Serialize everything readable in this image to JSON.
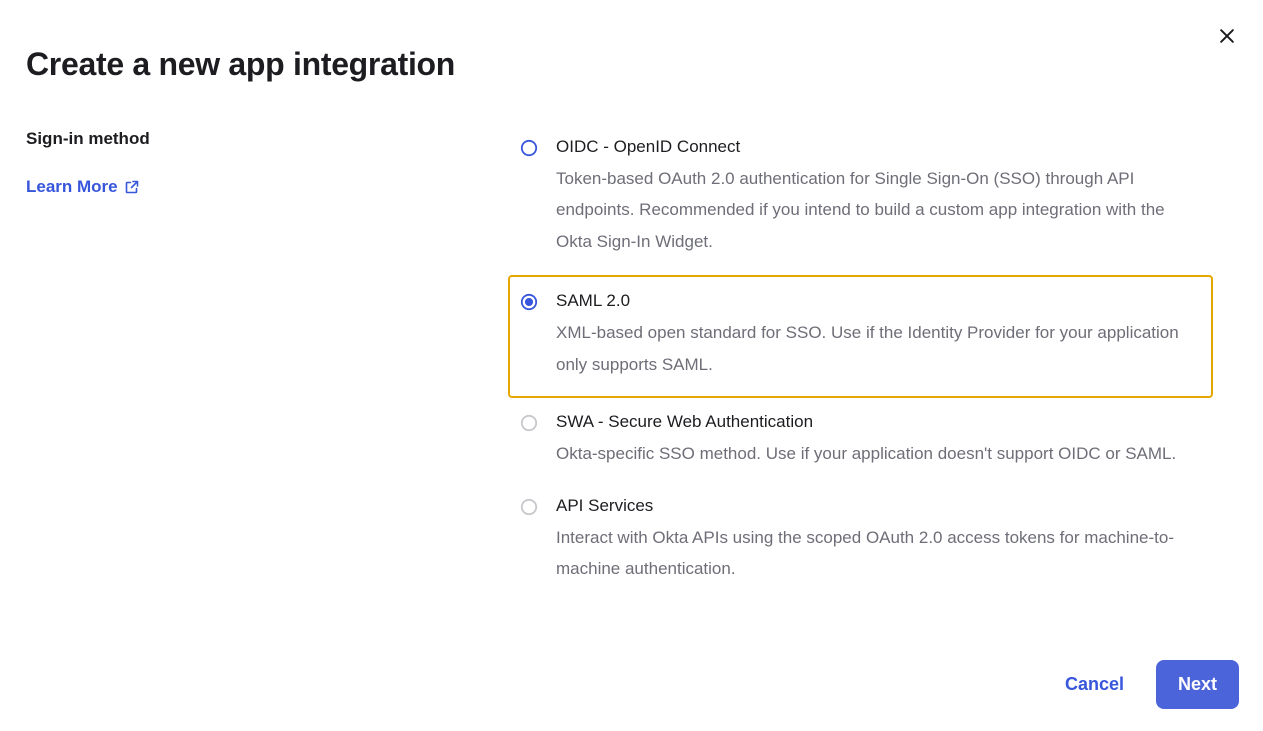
{
  "title": "Create a new app integration",
  "section_label": "Sign-in method",
  "learn_more_label": "Learn More",
  "options": [
    {
      "id": "oidc",
      "title": "OIDC - OpenID Connect",
      "desc": "Token-based OAuth 2.0 authentication for Single Sign-On (SSO) through API endpoints. Recommended if you intend to build a custom app integration with the Okta Sign-In Widget.",
      "selected": false,
      "disabled": false,
      "highlighted": false
    },
    {
      "id": "saml",
      "title": "SAML 2.0",
      "desc": "XML-based open standard for SSO. Use if the Identity Provider for your application only supports SAML.",
      "selected": true,
      "disabled": false,
      "highlighted": true
    },
    {
      "id": "swa",
      "title": "SWA - Secure Web Authentication",
      "desc": "Okta-specific SSO method. Use if your application doesn't support OIDC or SAML.",
      "selected": false,
      "disabled": true,
      "highlighted": false
    },
    {
      "id": "api",
      "title": "API Services",
      "desc": "Interact with Okta APIs using the scoped OAuth 2.0 access tokens for machine-to-machine authentication.",
      "selected": false,
      "disabled": true,
      "highlighted": false
    }
  ],
  "footer": {
    "cancel_label": "Cancel",
    "next_label": "Next"
  },
  "colors": {
    "primary": "#4c64d9",
    "link": "#3756db",
    "highlight_border": "#e6a700",
    "muted_text": "#6e6e78"
  }
}
